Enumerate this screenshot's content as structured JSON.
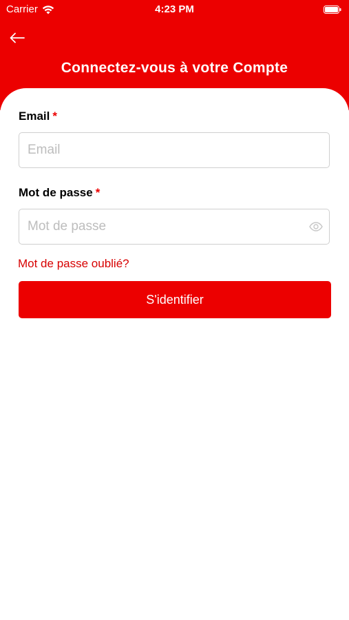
{
  "status_bar": {
    "carrier": "Carrier",
    "time": "4:23 PM",
    "wifi_icon": "wifi-icon",
    "battery_icon": "battery-icon"
  },
  "header": {
    "back_icon": "arrow-left-icon",
    "title": "Connectez-vous à votre Compte",
    "background_color": "#EC0000"
  },
  "form": {
    "email": {
      "label": "Email",
      "required_mark": "*",
      "placeholder": "Email",
      "value": ""
    },
    "password": {
      "label": "Mot de passe",
      "required_mark": "*",
      "placeholder": "Mot de passe",
      "value": "",
      "toggle_icon": "eye-icon"
    },
    "forgot_password_label": "Mot de passe oublié?",
    "submit_label": "S'identifier"
  },
  "colors": {
    "accent": "#EC0000",
    "link": "#D70000",
    "placeholder": "#BDBDBD",
    "input_border": "#CFCFCF"
  }
}
